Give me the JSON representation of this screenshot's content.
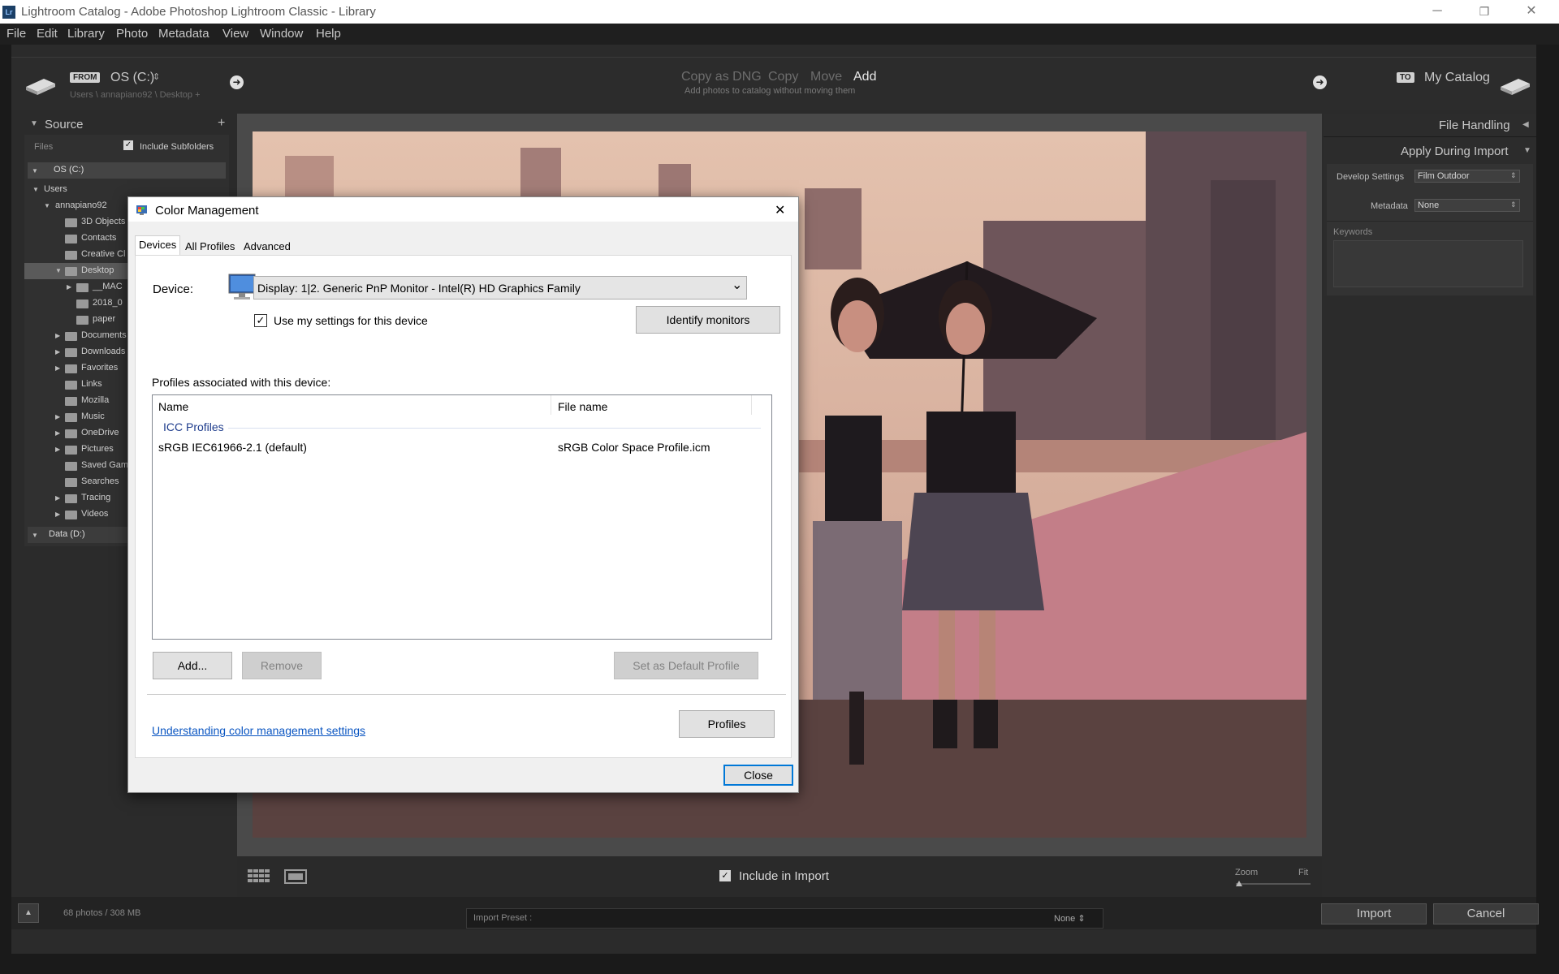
{
  "window": {
    "logo": "Lr",
    "title": "Lightroom Catalog - Adobe Photoshop Lightroom Classic - Library",
    "minimize_icon": "─",
    "restore_icon": "❐",
    "close_icon": "✕"
  },
  "menu": [
    "File",
    "Edit",
    "Library",
    "Photo",
    "Metadata",
    "View",
    "Window",
    "Help"
  ],
  "header": {
    "from_badge": "FROM",
    "source_drive": "OS (C:)",
    "source_dropdown_icon": "⇕",
    "source_path": "Users \\ annapiano92 \\ Desktop +",
    "modes": [
      "Copy as DNG",
      "Copy",
      "Move",
      "Add"
    ],
    "active_mode": "Add",
    "mode_description": "Add photos to catalog without moving them",
    "to_badge": "TO",
    "destination": "My Catalog",
    "arrow_icon": "➜"
  },
  "source_panel": {
    "title": "Source",
    "collapse_icon": "▼",
    "add_icon": "+",
    "files_label": "Files",
    "include_subfolders": "Include Subfolders",
    "include_subfolders_checked": true,
    "drive_c": "OS (C:)",
    "drive_d": "Data (D:)",
    "tree": [
      {
        "label": "Users",
        "indent": 0,
        "tri": "▼",
        "folder": false
      },
      {
        "label": "annapiano92",
        "indent": 1,
        "tri": "▼",
        "folder": false
      },
      {
        "label": "3D Objects",
        "indent": 2,
        "tri": "",
        "folder": true
      },
      {
        "label": "Contacts",
        "indent": 2,
        "tri": "",
        "folder": true
      },
      {
        "label": "Creative Cl",
        "indent": 2,
        "tri": "",
        "folder": true
      },
      {
        "label": "Desktop",
        "indent": 2,
        "tri": "▼",
        "folder": true,
        "selected": true
      },
      {
        "label": "__MAC",
        "indent": 3,
        "tri": "▶",
        "folder": true
      },
      {
        "label": "2018_0",
        "indent": 3,
        "tri": "",
        "folder": true
      },
      {
        "label": "paper",
        "indent": 3,
        "tri": "",
        "folder": true
      },
      {
        "label": "Documents",
        "indent": 2,
        "tri": "▶",
        "folder": true
      },
      {
        "label": "Downloads",
        "indent": 2,
        "tri": "▶",
        "folder": true
      },
      {
        "label": "Favorites",
        "indent": 2,
        "tri": "▶",
        "folder": true
      },
      {
        "label": "Links",
        "indent": 2,
        "tri": "",
        "folder": true
      },
      {
        "label": "Mozilla",
        "indent": 2,
        "tri": "",
        "folder": true
      },
      {
        "label": "Music",
        "indent": 2,
        "tri": "▶",
        "folder": true
      },
      {
        "label": "OneDrive",
        "indent": 2,
        "tri": "▶",
        "folder": true
      },
      {
        "label": "Pictures",
        "indent": 2,
        "tri": "▶",
        "folder": true
      },
      {
        "label": "Saved Gam",
        "indent": 2,
        "tri": "",
        "folder": true
      },
      {
        "label": "Searches",
        "indent": 2,
        "tri": "",
        "folder": true
      },
      {
        "label": "Tracing",
        "indent": 2,
        "tri": "▶",
        "folder": true
      },
      {
        "label": "Videos",
        "indent": 2,
        "tri": "▶",
        "folder": true
      }
    ]
  },
  "right_panel": {
    "file_handling": "File Handling",
    "file_handling_icon": "◀",
    "apply_during_import": "Apply During Import",
    "apply_icon": "▼",
    "develop_settings_label": "Develop Settings",
    "develop_settings_value": "Film Outdoor",
    "metadata_label": "Metadata",
    "metadata_value": "None",
    "keywords_label": "Keywords",
    "select_icon": "⇕"
  },
  "bottom_toolbar": {
    "grid_icon": "grid-view-icon",
    "loupe_icon": "loupe-view-icon",
    "include_in_import": "Include in Import",
    "include_checked": true,
    "zoom_label": "Zoom",
    "zoom_fit": "Fit",
    "zoom_level": 0
  },
  "footer": {
    "expand_icon": "▲",
    "stats": "68 photos / 308 MB",
    "import_preset_label": "Import Preset :",
    "import_preset_value": "None ⇕",
    "import_button": "Import",
    "cancel_button": "Cancel"
  },
  "dialog": {
    "title": "Color Management",
    "close_icon": "✕",
    "tabs": [
      "Devices",
      "All Profiles",
      "Advanced"
    ],
    "active_tab": "Devices",
    "device_label": "Device:",
    "device_value": "Display: 1|2. Generic PnP Monitor - Intel(R) HD Graphics Family",
    "dropdown_icon": "⌄",
    "use_my_settings": "Use my settings for this device",
    "use_my_settings_checked": true,
    "identify_monitors": "Identify monitors",
    "profiles_label": "Profiles associated with this device:",
    "columns": [
      "Name",
      "File name"
    ],
    "group": "ICC Profiles",
    "rows": [
      {
        "name": "sRGB IEC61966-2.1 (default)",
        "file": "sRGB Color Space Profile.icm"
      }
    ],
    "add_button": "Add...",
    "remove_button": "Remove",
    "set_default_button": "Set as Default Profile",
    "help_link": "Understanding color management settings",
    "profiles_button": "Profiles",
    "close_button": "Close"
  }
}
